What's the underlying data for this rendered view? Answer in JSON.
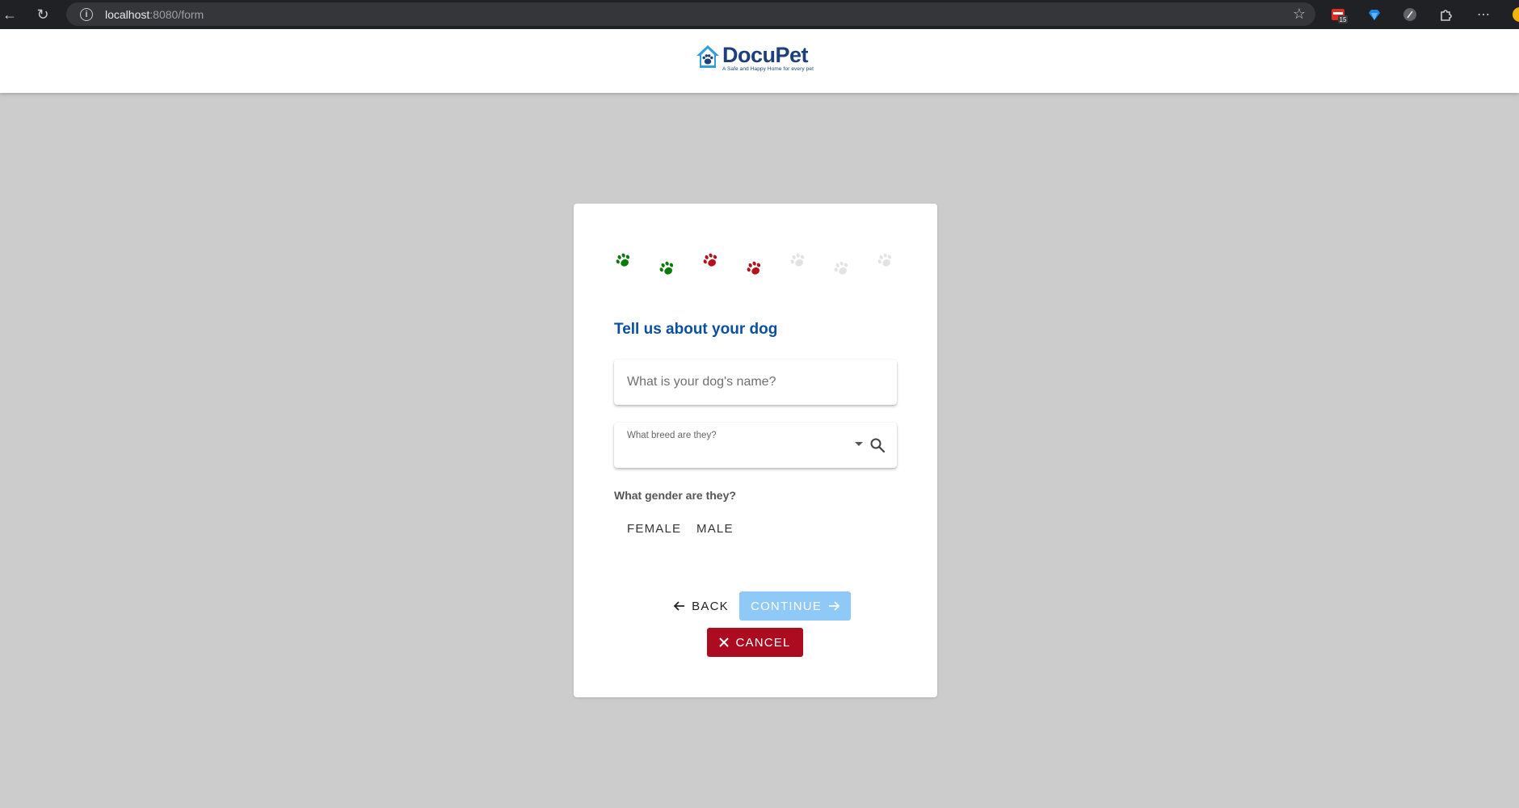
{
  "browser": {
    "url_host": "localhost",
    "url_path": ":8080/form",
    "badge_count": "15"
  },
  "app": {
    "logo_name": "DocuPet",
    "logo_tagline": "A Safe and Happy Home for every pet"
  },
  "progress": {
    "paws": [
      "green",
      "green",
      "red",
      "red",
      "gray",
      "gray",
      "gray"
    ],
    "colors": {
      "green": "#0b7a0b",
      "red": "#b5111c",
      "gray": "#e3e3e3"
    }
  },
  "form": {
    "title": "Tell us about your dog",
    "name_placeholder": "What is your dog's name?",
    "breed_label": "What breed are they?",
    "gender_label": "What gender are they?",
    "gender_options": [
      "FEMALE",
      "MALE"
    ]
  },
  "actions": {
    "back_label": "BACK",
    "continue_label": "CONTINUE",
    "cancel_label": "CANCEL"
  },
  "icons": {
    "back": "arrow-left-icon",
    "continue": "arrow-right-icon",
    "cancel": "close-icon",
    "breed_dropdown": "chevron-down-icon",
    "breed_search": "search-icon"
  }
}
